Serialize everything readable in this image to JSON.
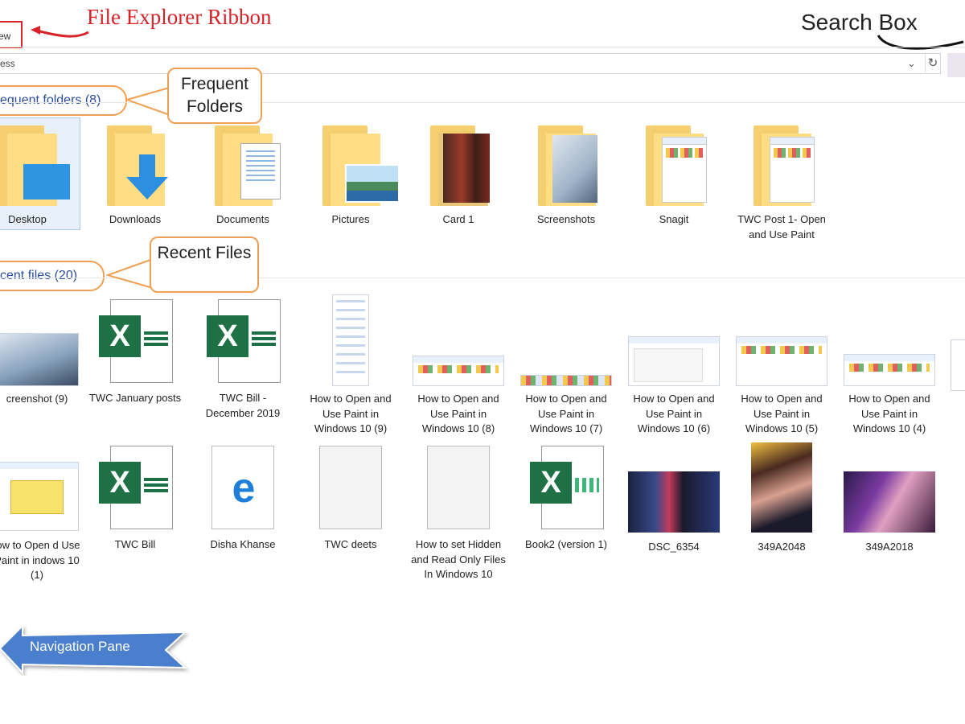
{
  "annotations": {
    "ribbon": "File Explorer Ribbon",
    "search_box": "Search Box",
    "frequent_folders": "Frequent Folders",
    "recent_files": "Recent Files",
    "navigation_pane": "Navigation Pane"
  },
  "ribbon": {
    "tab_label": "ew"
  },
  "address_bar": {
    "text": "ess"
  },
  "colors": {
    "accent": "#d8232a",
    "callout_border": "#f0a053",
    "link": "#2a4d9a",
    "excel": "#1e7145",
    "folder": "#f5ce6f",
    "arrow": "#4a7fcc"
  },
  "frequent": {
    "header": "equent folders (8)",
    "items": [
      {
        "label": "Desktop",
        "icon": "desktop-folder-icon"
      },
      {
        "label": "Downloads",
        "icon": "downloads-folder-icon"
      },
      {
        "label": "Documents",
        "icon": "documents-folder-icon"
      },
      {
        "label": "Pictures",
        "icon": "pictures-folder-icon"
      },
      {
        "label": "Card 1",
        "icon": "photo-folder-icon"
      },
      {
        "label": "Screenshots",
        "icon": "screenshots-folder-icon"
      },
      {
        "label": "Snagit",
        "icon": "snagit-folder-icon"
      },
      {
        "label": "TWC Post 1- Open and Use Paint",
        "icon": "folder-icon"
      }
    ]
  },
  "recent": {
    "header": "cent files (20)",
    "row1": [
      {
        "label": "creenshot (9)",
        "type": "image"
      },
      {
        "label": "TWC January posts",
        "type": "excel"
      },
      {
        "label": "TWC Bill - December 2019",
        "type": "excel"
      },
      {
        "label": "How to Open and Use Paint in Windows 10 (9)",
        "type": "screenshot"
      },
      {
        "label": "How to Open and Use Paint in Windows 10 (8)",
        "type": "screenshot"
      },
      {
        "label": "How to Open and Use Paint in Windows 10 (7)",
        "type": "screenshot"
      },
      {
        "label": "How to Open and Use Paint in Windows 10 (6)",
        "type": "screenshot"
      },
      {
        "label": "How to Open and Use Paint in Windows 10 (5)",
        "type": "screenshot"
      },
      {
        "label": "How to Open and Use Paint in Windows 10 (4)",
        "type": "screenshot"
      }
    ],
    "row2": [
      {
        "label": "low to Open d Use Paint in indows 10 (1)",
        "type": "screenshot"
      },
      {
        "label": "TWC Bill",
        "type": "excel"
      },
      {
        "label": "Disha Khanse",
        "type": "edge"
      },
      {
        "label": "TWC deets",
        "type": "blank"
      },
      {
        "label": "How to set Hidden and Read Only Files In Windows 10",
        "type": "blank"
      },
      {
        "label": "Book2 (version 1)",
        "type": "excel"
      },
      {
        "label": "DSC_6354",
        "type": "photo"
      },
      {
        "label": "349A2048",
        "type": "photo"
      },
      {
        "label": "349A2018",
        "type": "photo"
      }
    ]
  }
}
